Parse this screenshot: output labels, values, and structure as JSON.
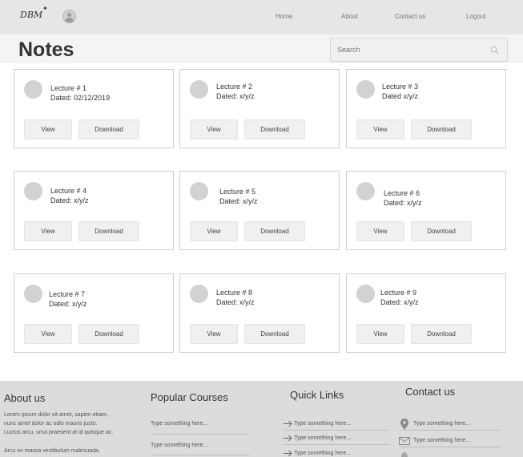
{
  "nav": {
    "logo": "DBM",
    "links": [
      "Home",
      "About",
      "Contact us",
      "Logout"
    ]
  },
  "page": {
    "title": "Notes",
    "search_placeholder": "Search"
  },
  "cards": [
    {
      "title": "Lecture # 1",
      "dated": "Dated: 02/12/2019"
    },
    {
      "title": "Lecture # 2",
      "dated": "Dated: x/y/z"
    },
    {
      "title": "Lecture # 3",
      "dated": "Dated x/y/z"
    },
    {
      "title": "Lecture # 4",
      "dated": "Dated: x/y/z"
    },
    {
      "title": "Lecture # 5",
      "dated": "Dated: x/y/z"
    },
    {
      "title": "Lecture # 6",
      "dated": "Dated: x/y/z"
    },
    {
      "title": "Lecture # 7",
      "dated": "Dated: x/y/z"
    },
    {
      "title": "Lecture # 8",
      "dated": "Dated: x/y/z"
    },
    {
      "title": "Lecture # 9",
      "dated": "Dated: x/y/z"
    }
  ],
  "buttons": {
    "view": "View",
    "download": "Download"
  },
  "footer": {
    "about": {
      "heading": "About us",
      "lines": [
        "Lorem ipsum dolor sit amet, sapien etiam,",
        "nunc amet dolor ac odio mauris justo.",
        "Luctus arcu, urna praesent at id quisque ac.",
        "Arcu es massa vestibulum malesuada,"
      ]
    },
    "popular": {
      "heading": "Popular Courses",
      "items": [
        "Type something here...",
        "Type something here..."
      ]
    },
    "quick": {
      "heading": "Quick Links",
      "items": [
        "Type something here...",
        "Type something here...",
        "Type something here..."
      ]
    },
    "contact": {
      "heading": "Contact us",
      "items": [
        "Type something here...",
        "Type something here..."
      ]
    }
  }
}
